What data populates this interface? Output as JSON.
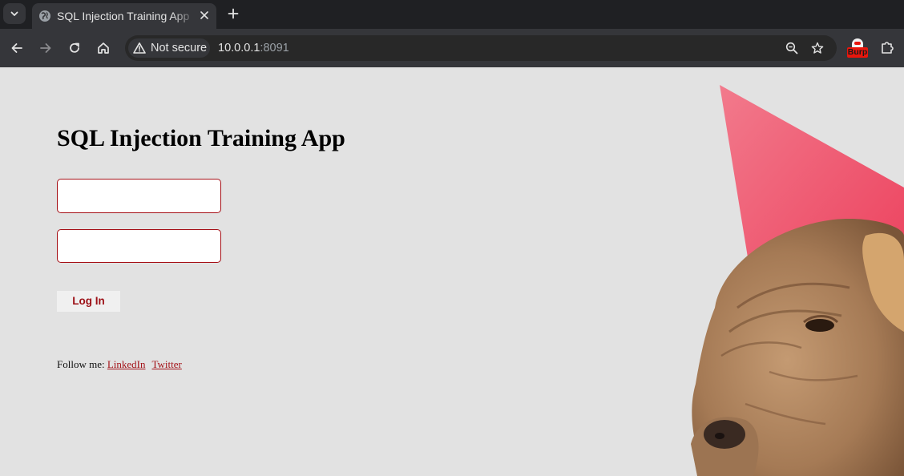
{
  "browser": {
    "tab": {
      "title": "SQL Injection Training App"
    },
    "address_bar": {
      "security_label": "Not secure",
      "host": "10.0.0.1",
      "port": ":8091"
    },
    "extensions": {
      "burp_label": "Burp"
    }
  },
  "page": {
    "heading": "SQL Injection Training App",
    "username_field": {
      "value": "",
      "placeholder": ""
    },
    "password_field": {
      "value": "",
      "placeholder": ""
    },
    "login_button": "Log In",
    "follow": {
      "prefix": "Follow me:",
      "links": [
        "LinkedIn",
        "Twitter"
      ]
    }
  },
  "colors": {
    "page_background": "#e2e2e2",
    "accent_red": "#a50f16",
    "party_hat": "#f0556f"
  }
}
